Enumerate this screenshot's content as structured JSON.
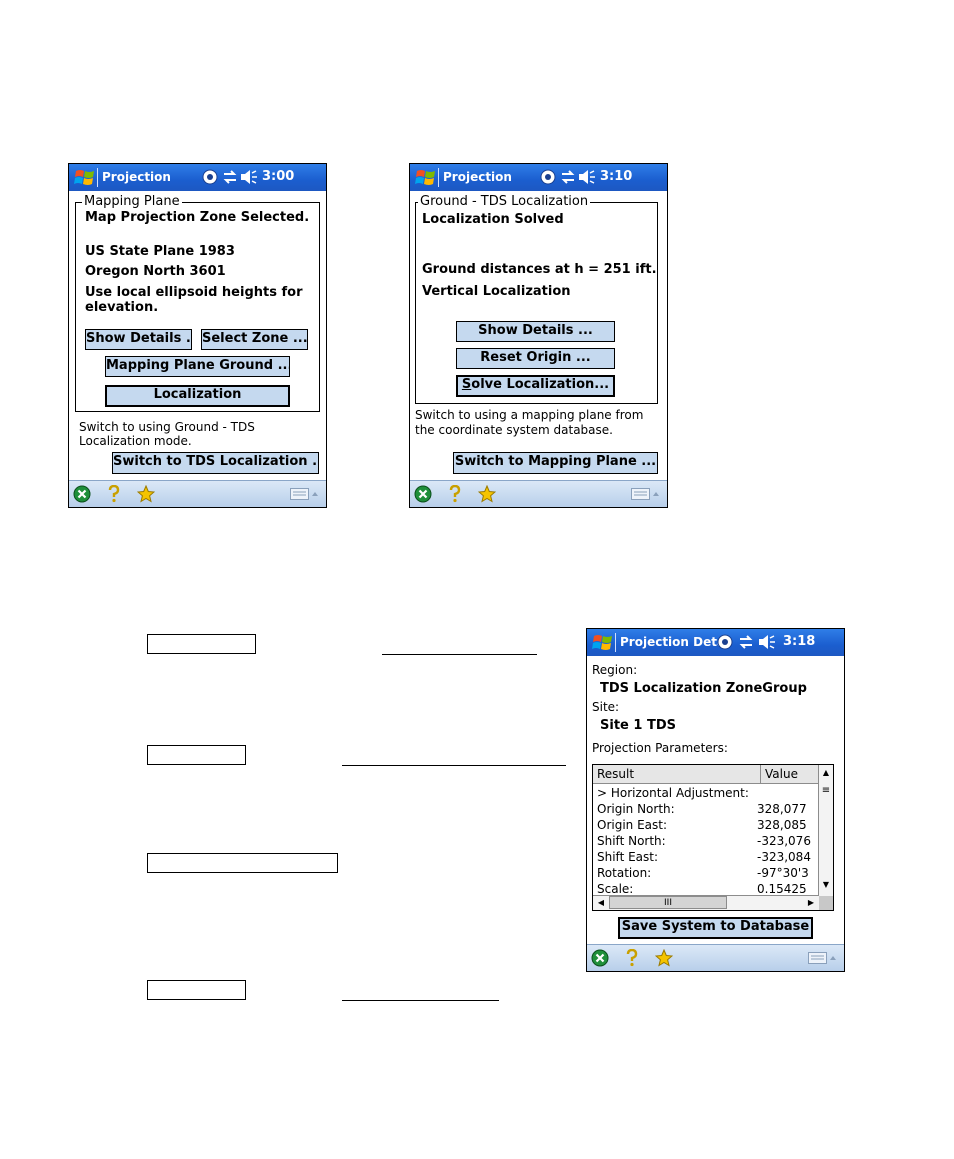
{
  "screen1": {
    "title": "Projection",
    "time": "3:00",
    "groupbox_label": "Mapping Plane",
    "lines": [
      "Map Projection Zone Selected.",
      "US State Plane 1983",
      "Oregon North 3601",
      "Use local ellipsoid heights for",
      "elevation."
    ],
    "show_details": "Show Details ...",
    "select_zone": "Select Zone ...",
    "mapping_plane_ground": "Mapping Plane Ground ...",
    "localization": "Localization",
    "info_line1": "Switch to using  Ground - TDS",
    "info_line2": "Localization mode.",
    "switch_button": "Switch to TDS Localization ..."
  },
  "screen2": {
    "title": "Projection",
    "time": "3:10",
    "groupbox_label": "Ground - TDS Localization",
    "lines": [
      "Localization Solved",
      "Ground distances at h = 251  ift.",
      "Vertical Localization"
    ],
    "show_details": "Show Details ...",
    "reset_origin": "Reset Origin ...",
    "solve_accel": "S",
    "solve_rest": "olve Localization...",
    "info_line1": "Switch to using a mapping plane from",
    "info_line2": "the coordinate system database.",
    "switch_button": "Switch to Mapping Plane ..."
  },
  "screen3": {
    "title": "Projection Deta",
    "time": "3:18",
    "region_label": "Region:",
    "region_value": "TDS Localization ZoneGroup",
    "site_label": "Site:",
    "site_value": "Site 1 TDS",
    "params_label": "Projection Parameters:",
    "columns": [
      "Result",
      "Value"
    ],
    "rows": [
      {
        "result": "> Horizontal Adjustment:",
        "value": ""
      },
      {
        "result": "Origin North:",
        "value": "328,077"
      },
      {
        "result": "Origin East:",
        "value": "328,085"
      },
      {
        "result": "Shift North:",
        "value": "-323,076"
      },
      {
        "result": "Shift East:",
        "value": "-323,084"
      },
      {
        "result": "Rotation:",
        "value": "-97°30'3"
      },
      {
        "result": "Scale:",
        "value": "0.15425"
      }
    ],
    "scroll_thumb": "III",
    "save_button": "Save System to Database"
  },
  "colors": {
    "titlebar": "#1b5ecf",
    "button_fill": "#c5d9ef",
    "bottombar": "#c8dbf0"
  },
  "icons": {
    "start": "windows-logo-icon",
    "connectivity": "connectivity-icon",
    "sync": "sync-arrows-icon",
    "volume": "speaker-icon",
    "close": "close-circle-icon",
    "help": "help-icon",
    "favorites": "favorites-star-icon",
    "keyboard": "keyboard-icon"
  }
}
